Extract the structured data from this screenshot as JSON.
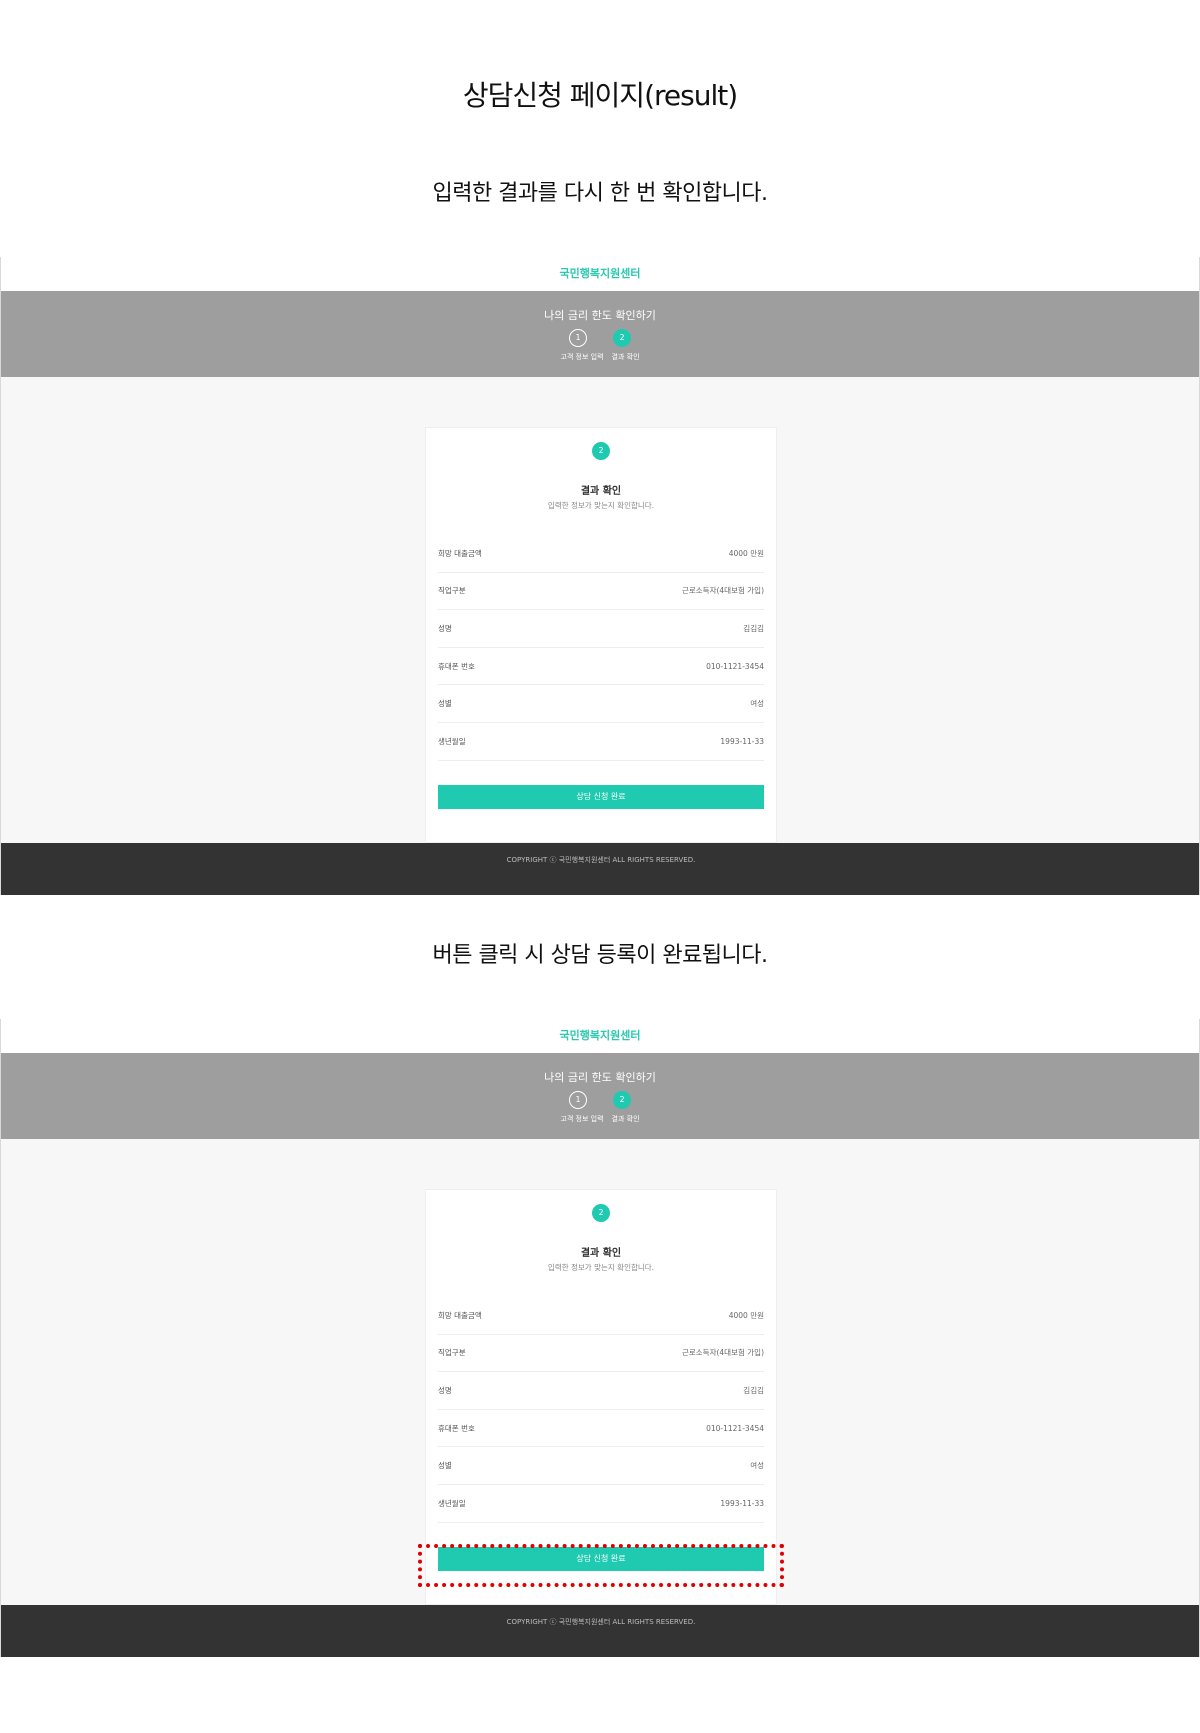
{
  "doc": {
    "title": "상담신청 페이지(result)",
    "caption_1": "입력한 결과를 다시 한 번 확인합니다.",
    "caption_2": "버튼 클릭 시 상담 등록이 완료됩니다."
  },
  "site": {
    "brand": "국민행복지원센터",
    "banner_title": "나의 금리 한도 확인하기",
    "steps": [
      {
        "num": "1",
        "label": "고객 정보 입력"
      },
      {
        "num": "2",
        "label": "결과 확인"
      }
    ],
    "footer": "COPYRIGHT ⓒ 국민행복지원센터 ALL RIGHTS RESERVED."
  },
  "card": {
    "step_num": "2",
    "title": "결과 확인",
    "subtitle": "입력한 정보가 맞는지 확인합니다.",
    "rows": [
      {
        "label": "희망 대출금액",
        "value": "4000 만원"
      },
      {
        "label": "직업구분",
        "value": "근로소득자(4대보험 가입)"
      },
      {
        "label": "성명",
        "value": "김김김"
      },
      {
        "label": "휴대폰 번호",
        "value": "010-1121-3454"
      },
      {
        "label": "성별",
        "value": "여성"
      },
      {
        "label": "생년월일",
        "value": "1993-11-33"
      }
    ],
    "submit_label": "상담 신청 완료"
  },
  "colors": {
    "accent": "#1fcab0",
    "banner": "#9e9e9e",
    "footer": "#333333",
    "highlight": "#e00000"
  }
}
